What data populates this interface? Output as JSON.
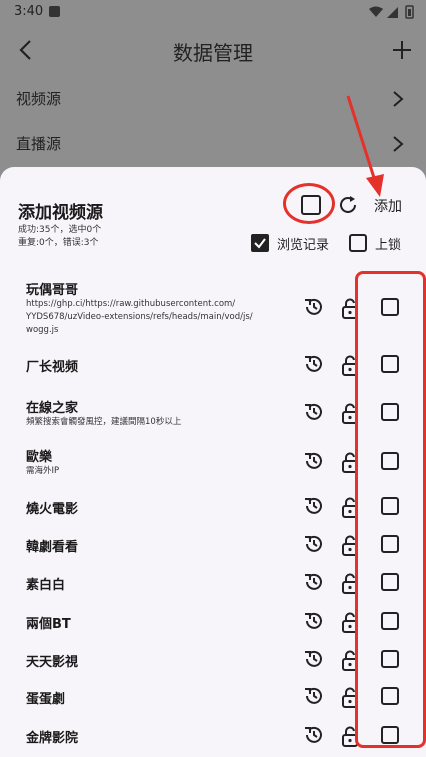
{
  "status_bar": {
    "time": "3:40"
  },
  "app_bar": {
    "title": "数据管理"
  },
  "background_rows": [
    {
      "label": "视频源"
    },
    {
      "label": "直播源"
    }
  ],
  "sheet": {
    "title": "添加视频源",
    "stats_line1": "成功:35个，选中0个",
    "stats_line2": "重复:0个，错误:3个",
    "add_label": "添加",
    "history_option_label": "浏览记录",
    "lock_option_label": "上锁",
    "items": [
      {
        "name": "玩偶哥哥",
        "sub": "https://ghp.ci/https://raw.githubusercontent.com/\nYYDS678/uzVideo-extensions/refs/heads/main/vod/js/\nwogg.js"
      },
      {
        "name": "厂长视频",
        "sub": ""
      },
      {
        "name": "在線之家",
        "sub": "頻繁搜索會觸發風控，建議間隔10秒以上"
      },
      {
        "name": "歐樂",
        "sub": "需海外IP"
      },
      {
        "name": "燒火電影",
        "sub": ""
      },
      {
        "name": "韓劇看看",
        "sub": ""
      },
      {
        "name": "素白白",
        "sub": ""
      },
      {
        "name": "兩個BT",
        "sub": ""
      },
      {
        "name": "天天影視",
        "sub": ""
      },
      {
        "name": "蛋蛋劇",
        "sub": ""
      },
      {
        "name": "金牌影院",
        "sub": ""
      }
    ]
  },
  "colors": {
    "annotation": "#e4322b",
    "sheet_bg": "#f7f5fa",
    "scrim": "#8e8e8e"
  }
}
